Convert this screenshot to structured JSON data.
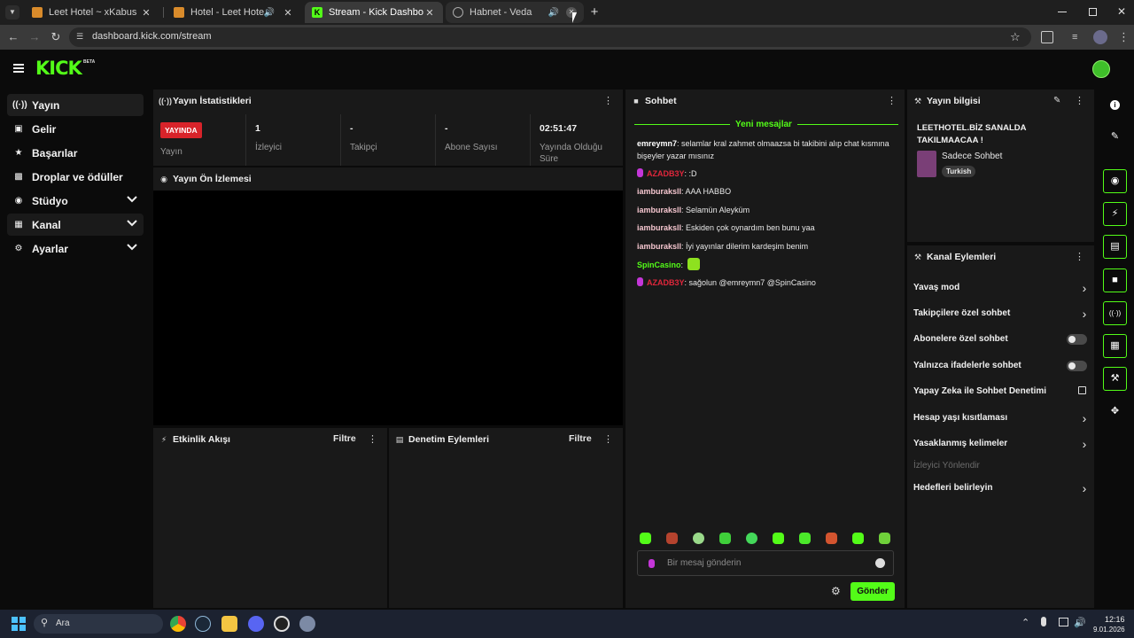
{
  "browser": {
    "tabs": [
      {
        "title": "Leet Hotel ~ xKabus",
        "state": "normal"
      },
      {
        "title": "Hotel - Leet Hotel",
        "state": "normal"
      },
      {
        "title": "Stream - Kick Dashboard",
        "state": "active"
      },
      {
        "title": "Habnet - Veda",
        "state": "hover"
      }
    ],
    "url": "dashboard.kick.com/stream"
  },
  "header": {
    "logo": "KICK",
    "logo_badge": "BETA"
  },
  "sidebar": {
    "items": [
      {
        "label": "Yayın",
        "icon": "broadcast-icon"
      },
      {
        "label": "Gelir",
        "icon": "revenue-icon"
      },
      {
        "label": "Başarılar",
        "icon": "trophy-icon"
      },
      {
        "label": "Droplar ve ödüller",
        "icon": "gift-icon"
      },
      {
        "label": "Stüdyo",
        "icon": "studio-icon"
      },
      {
        "label": "Kanal",
        "icon": "channel-icon"
      },
      {
        "label": "Ayarlar",
        "icon": "gear-icon"
      }
    ]
  },
  "stats": {
    "title": "Yayın İstatistikleri",
    "live_badge": "YAYINDA",
    "items": [
      {
        "value": "",
        "label": "Yayın"
      },
      {
        "value": "1",
        "label": "İzleyici"
      },
      {
        "value": "-",
        "label": "Takipçi"
      },
      {
        "value": "-",
        "label": "Abone Sayısı"
      },
      {
        "value": "02:51:47",
        "label": "Yayında Olduğu Süre"
      }
    ]
  },
  "preview": {
    "title": "Yayın Ön İzlemesi"
  },
  "activity": {
    "title": "Etkinlik Akışı",
    "filter": "Filtre"
  },
  "moderation": {
    "title": "Denetim Eylemleri",
    "filter": "Filtre"
  },
  "chat": {
    "title": "Sohbet",
    "new_messages": "Yeni mesajlar",
    "messages": [
      {
        "user": "emreymn7",
        "color": "#ffffff",
        "mic": false,
        "text": "selamlar kral zahmet olmaazsa bi takibini alıp chat kısmına bişeyler yazar mısınız"
      },
      {
        "user": "AZADB3Y",
        "color": "#e0263b",
        "mic": true,
        "text": ":D"
      },
      {
        "user": "iamburaksll",
        "color": "#f5c6cf",
        "mic": false,
        "text": "AAA HABBO"
      },
      {
        "user": "iamburaksll",
        "color": "#f5c6cf",
        "mic": false,
        "text": "Selamün Aleyküm"
      },
      {
        "user": "iamburaksll",
        "color": "#f5c6cf",
        "mic": false,
        "text": "Eskiden çok oynardım ben bunu yaa"
      },
      {
        "user": "iamburaksll",
        "color": "#f5c6cf",
        "mic": false,
        "text": "İyi yayınlar dilerim kardeşim benim"
      },
      {
        "user": "SpinCasino",
        "color": "#53fc18",
        "mic": false,
        "text": ""
      },
      {
        "user": "AZADB3Y",
        "color": "#e0263b",
        "mic": true,
        "text": "sağolun @emreymn7 @SpinCasino"
      }
    ],
    "input_placeholder": "Bir mesaj gönderin",
    "send_label": "Gönder"
  },
  "stream_info": {
    "title": "Yayın bilgisi",
    "stream_title": "LEETHOTEL.BİZ SANALDA TAKILMAACAA !",
    "category": "Sadece Sohbet",
    "tag": "Turkish"
  },
  "channel_actions": {
    "title": "Kanal Eylemleri",
    "items": [
      {
        "label": "Yavaş mod",
        "control": "chevron"
      },
      {
        "label": "Takipçilere özel sohbet",
        "control": "chevron"
      },
      {
        "label": "Abonelere özel sohbet",
        "control": "toggle",
        "on": false
      },
      {
        "label": "Yalnızca ifadelerle sohbet",
        "control": "toggle",
        "on": false
      },
      {
        "label": "Yapay Zeka ile Sohbet Denetimi",
        "control": "external"
      },
      {
        "label": "Hesap yaşı kısıtlaması",
        "control": "chevron"
      },
      {
        "label": "Yasaklanmış kelimeler",
        "control": "chevron"
      },
      {
        "label": "İzleyici Yönlendir",
        "control": "none",
        "disabled": true
      },
      {
        "label": "Hedefleri belirleyin",
        "control": "chevron"
      }
    ]
  },
  "taskbar": {
    "search_placeholder": "Ara",
    "time": "12:16",
    "date": "9.01.2026"
  },
  "colors": {
    "accent": "#53fc18",
    "live": "#d8232a",
    "panel": "#191919",
    "bg": "#0b0b0b"
  }
}
